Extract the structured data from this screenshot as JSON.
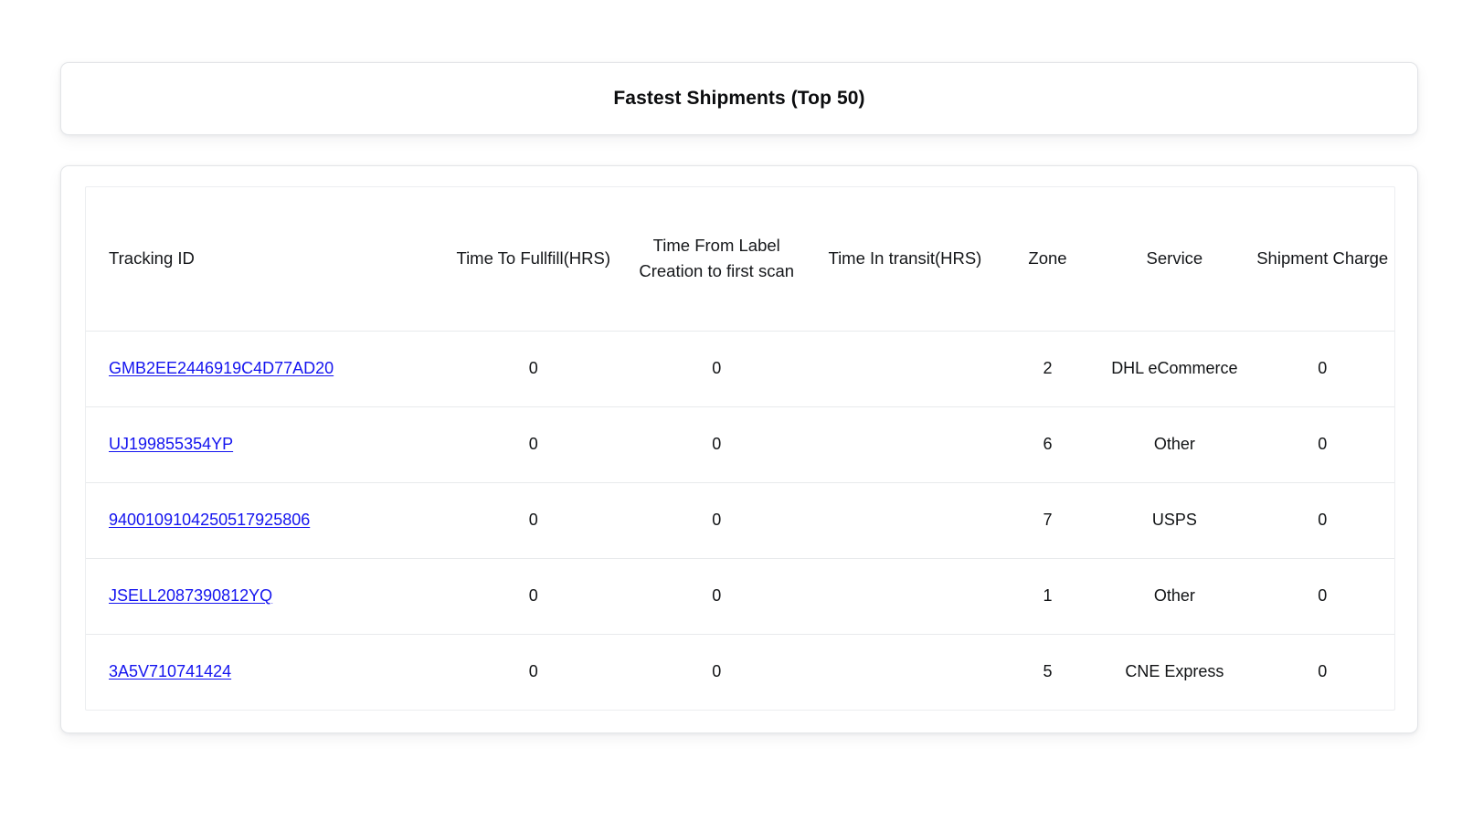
{
  "header": {
    "title": "Fastest Shipments (Top 50)"
  },
  "table": {
    "columns": [
      {
        "key": "tracking_id",
        "label": "Tracking ID"
      },
      {
        "key": "time_to_fulfill",
        "label": "Time To Fullfill(HRS)"
      },
      {
        "key": "time_from_label_creation",
        "label": "Time From Label Creation to first scan"
      },
      {
        "key": "time_in_transit",
        "label": "Time In transit(HRS)"
      },
      {
        "key": "zone",
        "label": "Zone"
      },
      {
        "key": "service",
        "label": "Service"
      },
      {
        "key": "shipment_charge",
        "label": "Shipment Charge"
      }
    ],
    "rows": [
      {
        "tracking_id": "GMB2EE2446919C4D77AD20",
        "time_to_fulfill": "0",
        "time_from_label_creation": "0",
        "time_in_transit": "",
        "zone": "2",
        "service": "DHL eCommerce",
        "shipment_charge": "0"
      },
      {
        "tracking_id": "UJ199855354YP",
        "time_to_fulfill": "0",
        "time_from_label_creation": "0",
        "time_in_transit": "",
        "zone": "6",
        "service": "Other",
        "shipment_charge": "0"
      },
      {
        "tracking_id": "9400109104250517925806",
        "time_to_fulfill": "0",
        "time_from_label_creation": "0",
        "time_in_transit": "",
        "zone": "7",
        "service": "USPS",
        "shipment_charge": "0"
      },
      {
        "tracking_id": "JSELL2087390812YQ",
        "time_to_fulfill": "0",
        "time_from_label_creation": "0",
        "time_in_transit": "",
        "zone": "1",
        "service": "Other",
        "shipment_charge": "0"
      },
      {
        "tracking_id": "3A5V710741424",
        "time_to_fulfill": "0",
        "time_from_label_creation": "0",
        "time_in_transit": "",
        "zone": "5",
        "service": "CNE Express",
        "shipment_charge": "0"
      }
    ]
  },
  "colors": {
    "link": "#1414ef",
    "text": "#111315",
    "card_border": "#e3e5e8",
    "row_divider": "#e8eaec",
    "background": "#ffffff"
  }
}
